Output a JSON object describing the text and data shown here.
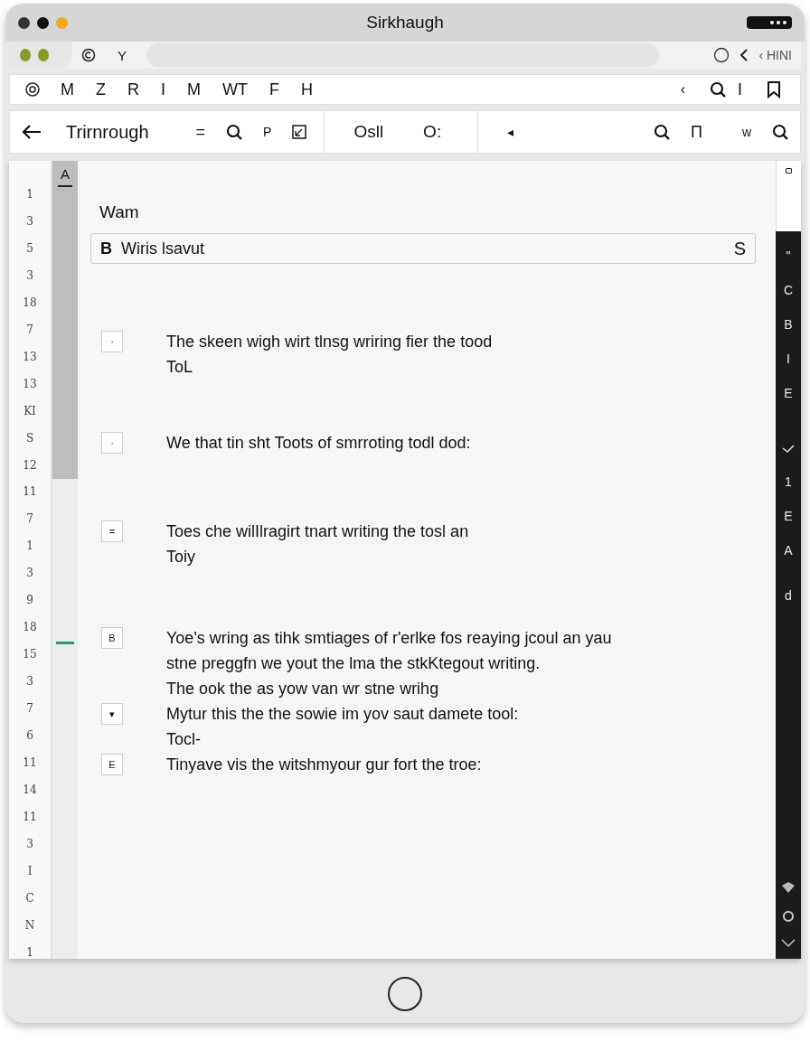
{
  "window": {
    "title": "Sirkhaugh"
  },
  "tab_bar": {
    "tab_label": "Y",
    "right_label": "‹ HINI"
  },
  "menu_bar": {
    "items": [
      "M",
      "Z",
      "R",
      "I",
      "M",
      "WT",
      "F",
      "H"
    ],
    "right_items": [
      "‹",
      "I"
    ]
  },
  "toolbar": {
    "title": "Trirnrough",
    "left_labels": [
      "=",
      "P"
    ],
    "middle_labels": [
      "Osll",
      "O:"
    ],
    "right_labels": [
      "◂",
      "Π",
      "w"
    ]
  },
  "rail": {
    "label": "A"
  },
  "line_numbers": [
    "1",
    "3",
    "5",
    "3",
    "18",
    "7",
    "13",
    "13",
    "KI",
    "S",
    "12",
    "11",
    "7",
    "1",
    "3",
    "9",
    "18",
    "15",
    "3",
    "7",
    "6",
    "11",
    "14",
    "11",
    "3",
    "I",
    "C",
    "N",
    "1"
  ],
  "document": {
    "heading": "Wam",
    "field": {
      "prefix": "B",
      "value": "Wiris lsavut",
      "suffix": "S"
    },
    "items": [
      {
        "marker": "·",
        "lines": [
          "The skeen wigh wirt tlnsg wriring fier the tood",
          "ToL"
        ]
      },
      {
        "marker": "·",
        "lines": [
          "We that tin sht Toots of smrroting todl dod:"
        ]
      },
      {
        "marker": "=",
        "lines": [
          "Toes che wilIlragirt tnart writing the tosl an",
          "Toiy"
        ]
      },
      {
        "marker": "B",
        "lines": [
          "Yoe's wring as tihk smtiages of r'erlke fos reaying jcoul an yau",
          "stne preggfn we yout the lma the stkKtegout writing.",
          "The ook the as yow van wr stne wrihg"
        ]
      },
      {
        "marker": "▾",
        "lines": [
          "Mytur this the the sowie im yov saut damete tool:",
          "Tocl-"
        ]
      },
      {
        "marker": "E",
        "lines": [
          "Tinyave vis the witshmyour gur fort the troe:"
        ]
      }
    ]
  },
  "sidebar": {
    "items": [
      {
        "kind": "text",
        "label": "\""
      },
      {
        "kind": "text",
        "label": "C"
      },
      {
        "kind": "text",
        "label": "B"
      },
      {
        "kind": "text",
        "label": "I"
      },
      {
        "kind": "text",
        "label": "E"
      },
      {
        "kind": "check"
      },
      {
        "kind": "text",
        "label": "1"
      },
      {
        "kind": "text",
        "label": "E"
      },
      {
        "kind": "text",
        "label": "A"
      },
      {
        "kind": "text",
        "label": "d"
      }
    ]
  }
}
